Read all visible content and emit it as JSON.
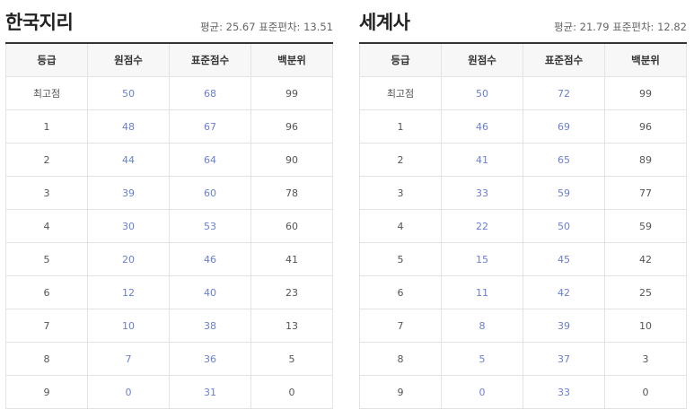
{
  "tables": [
    {
      "title": "한국지리",
      "stats": "평균: 25.67 표준편차: 13.51",
      "headers": [
        "등급",
        "원점수",
        "표준점수",
        "백분위"
      ],
      "rows": [
        [
          "최고점",
          "50",
          "68",
          "99"
        ],
        [
          "1",
          "48",
          "67",
          "96"
        ],
        [
          "2",
          "44",
          "64",
          "90"
        ],
        [
          "3",
          "39",
          "60",
          "78"
        ],
        [
          "4",
          "30",
          "53",
          "60"
        ],
        [
          "5",
          "20",
          "46",
          "41"
        ],
        [
          "6",
          "12",
          "40",
          "23"
        ],
        [
          "7",
          "10",
          "38",
          "13"
        ],
        [
          "8",
          "7",
          "36",
          "5"
        ],
        [
          "9",
          "0",
          "31",
          "0"
        ]
      ]
    },
    {
      "title": "세계사",
      "stats": "평균: 21.79 표준편차: 12.82",
      "headers": [
        "등급",
        "원점수",
        "표준점수",
        "백분위"
      ],
      "rows": [
        [
          "최고점",
          "50",
          "72",
          "99"
        ],
        [
          "1",
          "46",
          "69",
          "96"
        ],
        [
          "2",
          "41",
          "65",
          "89"
        ],
        [
          "3",
          "33",
          "59",
          "77"
        ],
        [
          "4",
          "22",
          "50",
          "59"
        ],
        [
          "5",
          "15",
          "45",
          "42"
        ],
        [
          "6",
          "11",
          "42",
          "25"
        ],
        [
          "7",
          "8",
          "39",
          "10"
        ],
        [
          "8",
          "5",
          "37",
          "3"
        ],
        [
          "9",
          "0",
          "33",
          "0"
        ]
      ]
    }
  ]
}
